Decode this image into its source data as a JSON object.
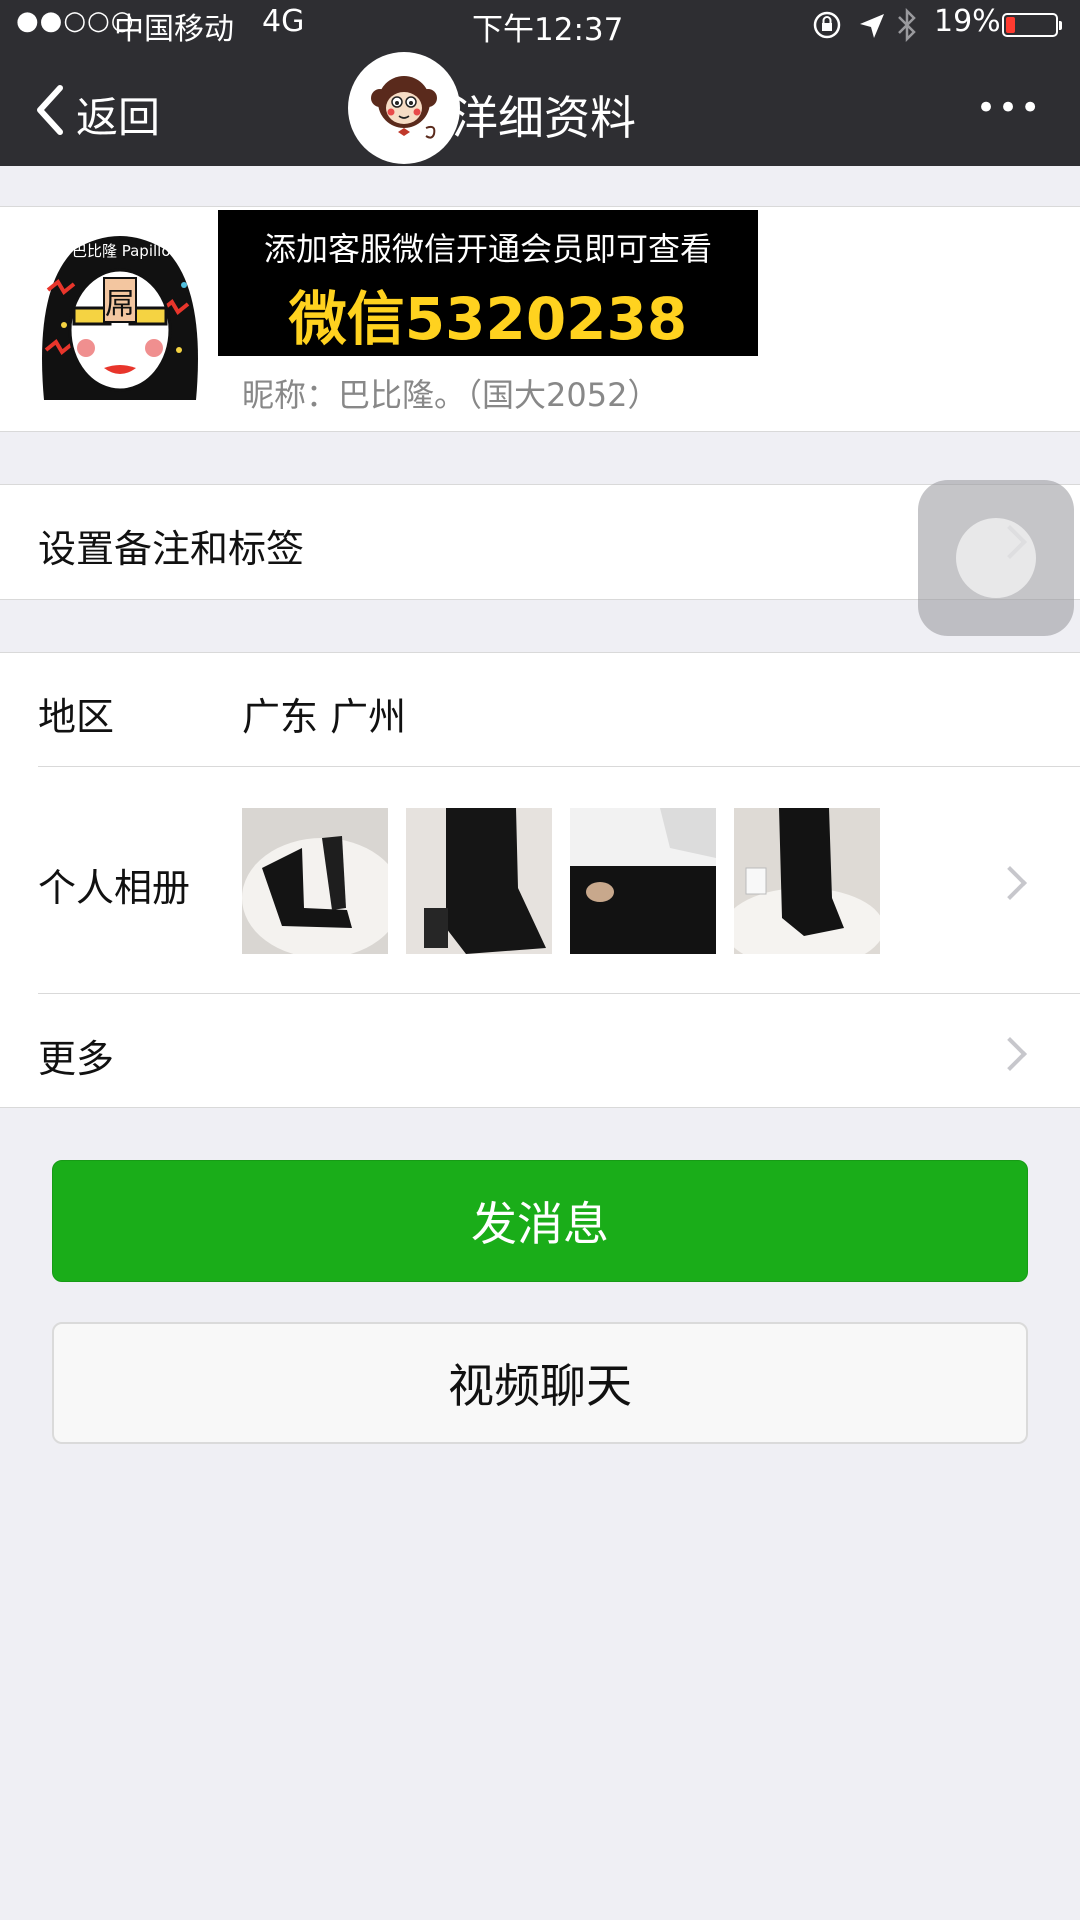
{
  "status_bar": {
    "signal": "●●○○○",
    "carrier": "中国移动",
    "network": "4G",
    "time": "下午12:37",
    "battery": "19%",
    "battery_level": 0.19
  },
  "nav": {
    "back_label": "返回",
    "title": "详细资料",
    "title_visible": "洋细资料",
    "more_label": "•••"
  },
  "profile": {
    "avatar_text": "巴比隆 Papillon",
    "avatar_center": "屌",
    "ad_line1": "添加客服微信开通会员即可查看",
    "ad_line2": "微信5320238",
    "nickname": "昵称：巴比隆。（国大2052）"
  },
  "rows": {
    "remark": {
      "label": "设置备注和标签"
    },
    "region": {
      "label": "地区",
      "value": "广东  广州"
    },
    "album": {
      "label": "个人相册"
    },
    "more": {
      "label": "更多"
    }
  },
  "actions": {
    "send_message": "发消息",
    "video_chat": "视频聊天"
  },
  "colors": {
    "nav_bg": "#2e2e32",
    "page_bg": "#efeff4",
    "send_button": "#1aad19",
    "ad_bg": "#000000",
    "ad_highlight": "#ffd21f"
  }
}
